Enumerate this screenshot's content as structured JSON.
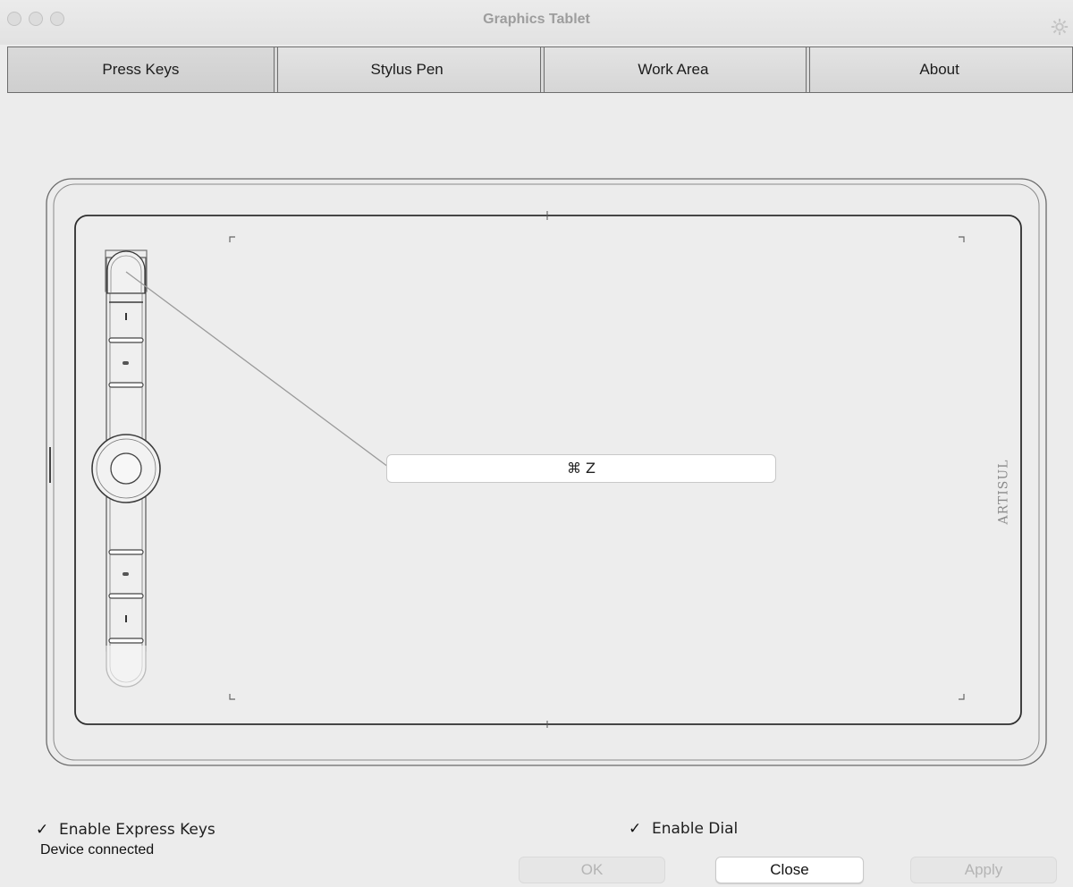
{
  "window": {
    "title": "Graphics Tablet"
  },
  "title_bar": {
    "controls": [
      "close",
      "minimize",
      "zoom"
    ],
    "settings_icon": "gear-icon"
  },
  "tabs": [
    {
      "label": "Press Keys",
      "active": true
    },
    {
      "label": "Stylus Pen",
      "active": false
    },
    {
      "label": "Work Area",
      "active": false
    },
    {
      "label": "About",
      "active": false
    }
  ],
  "tablet": {
    "selected_key_shortcut": "⌘ Z",
    "brand": "ARTISUL",
    "express_keys": [
      "key-1",
      "key-2",
      "key-3",
      "key-4",
      "key-5",
      "key-6",
      "key-7",
      "key-8"
    ],
    "dial": "dial"
  },
  "options": {
    "enable_express_keys": {
      "label": "Enable Express Keys",
      "checked": true
    },
    "enable_dial": {
      "label": "Enable Dial",
      "checked": true
    }
  },
  "status": "Device connected",
  "buttons": {
    "ok": {
      "label": "OK",
      "enabled": false
    },
    "close": {
      "label": "Close",
      "enabled": true
    },
    "apply": {
      "label": "Apply",
      "enabled": false
    }
  },
  "colors": {
    "window_bg": "#ececec",
    "outline": "#3a3a3a",
    "connector": "#9a9a9a"
  }
}
